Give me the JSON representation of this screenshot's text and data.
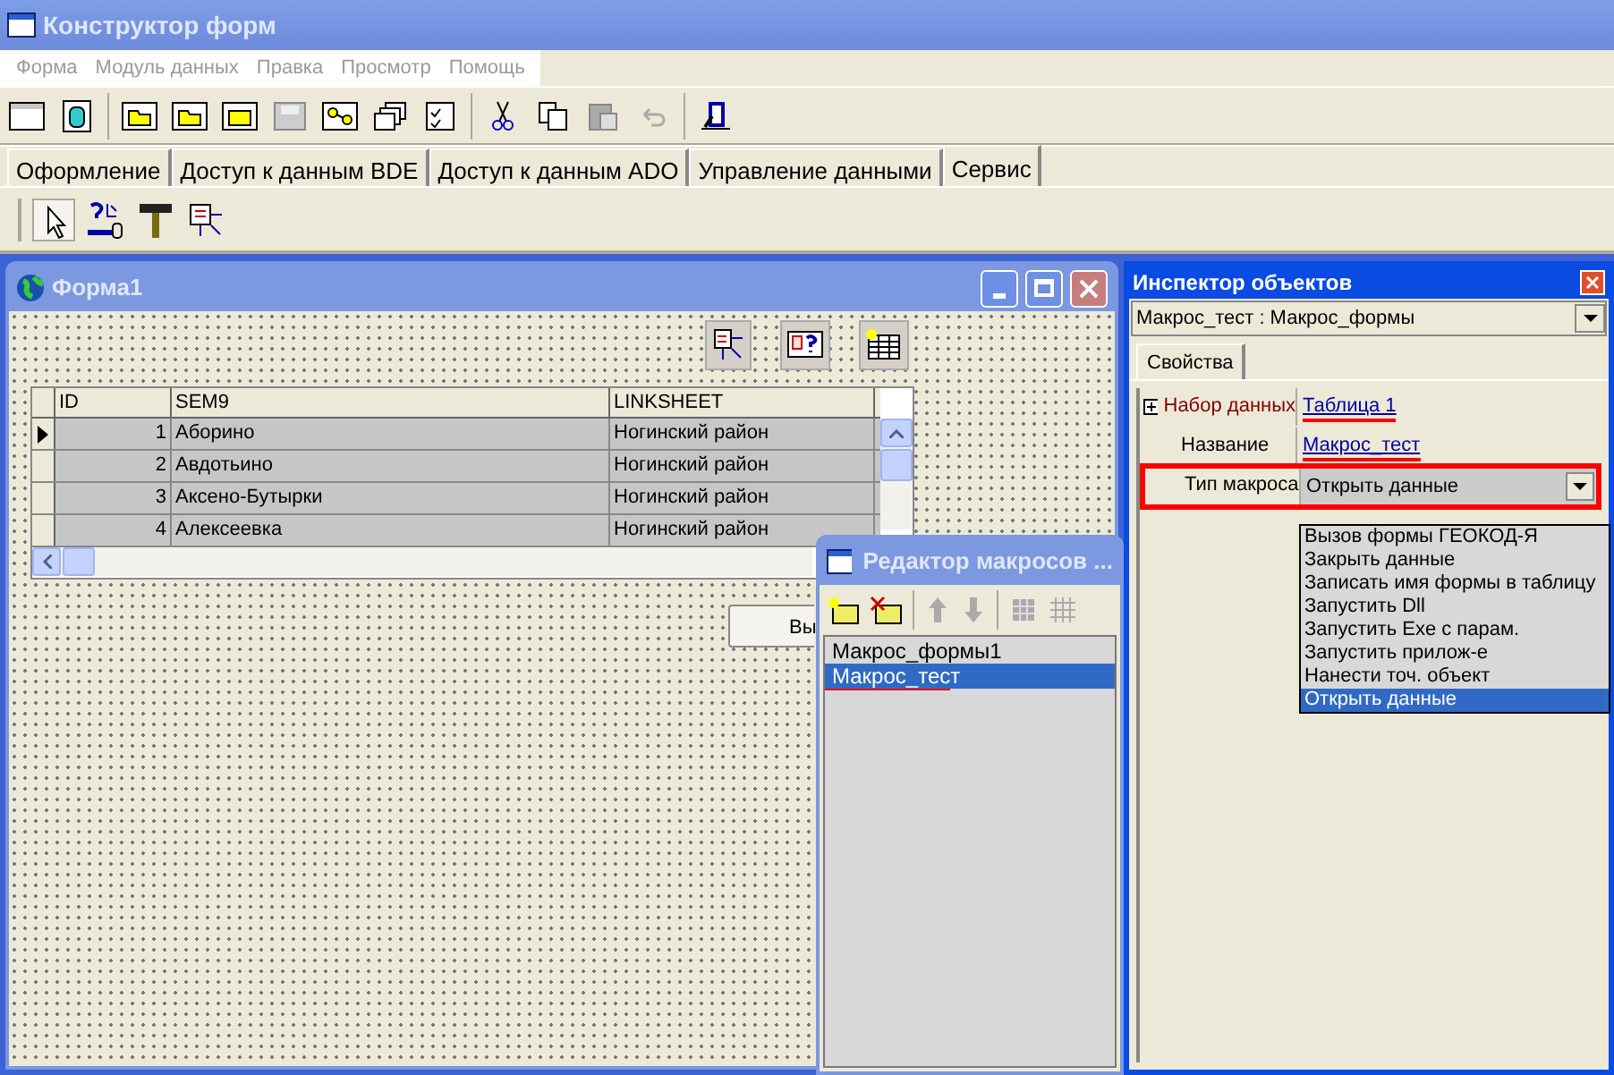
{
  "window": {
    "title": "Конструктор форм"
  },
  "menu": [
    "Форма",
    "Модуль данных",
    "Правка",
    "Просмотр",
    "Помощь"
  ],
  "palette_tabs": [
    {
      "label": "Оформление",
      "selected": false
    },
    {
      "label": "Доступ к данным BDE",
      "selected": false
    },
    {
      "label": "Доступ к данным ADO",
      "selected": false
    },
    {
      "label": "Управление данными",
      "selected": false
    },
    {
      "label": "Сервис",
      "selected": true
    }
  ],
  "form_window": {
    "title": "Форма1",
    "grid": {
      "columns": [
        "ID",
        "SEM9",
        "LINKSHEET"
      ],
      "rows": [
        {
          "id": "1",
          "sem9": "Аборино",
          "linksheet": "Ногинский район",
          "current": true
        },
        {
          "id": "2",
          "sem9": "Авдотьино",
          "linksheet": "Ногинский район",
          "current": false
        },
        {
          "id": "3",
          "sem9": "Аксено-Бутырки",
          "linksheet": "Ногинский район",
          "current": false
        },
        {
          "id": "4",
          "sem9": "Алексеевка",
          "linksheet": "Ногинский район",
          "current": false
        }
      ]
    },
    "button_label": "Вы"
  },
  "macro_editor": {
    "title": "Редактор макросов ...",
    "items": [
      {
        "label": "Макрос_формы1",
        "selected": false,
        "annotated": false
      },
      {
        "label": "Макрос_тест",
        "selected": true,
        "annotated": true
      }
    ]
  },
  "inspector": {
    "title": "Инспектор объектов",
    "object_selector": "Макрос_тест : Макрос_формы",
    "tabs": [
      {
        "label": "Свойства",
        "selected": true
      }
    ],
    "properties": [
      {
        "name": "Набор данных",
        "value": "Таблица 1",
        "kind": "expandable",
        "annotated": true
      },
      {
        "name": "Название",
        "value": "Макрос_тест",
        "kind": "text",
        "annotated": true
      },
      {
        "name": "Тип макроса",
        "value": "Открыть данные",
        "kind": "dropdown",
        "annotated": true
      }
    ],
    "dropdown_options": [
      {
        "label": "Вызов формы ГЕОКОД-Я",
        "selected": false
      },
      {
        "label": "Закрыть данные",
        "selected": false
      },
      {
        "label": "Записать имя формы в таблицу",
        "selected": false
      },
      {
        "label": "Запустить Dll",
        "selected": false
      },
      {
        "label": "Запустить Exe с парам.",
        "selected": false
      },
      {
        "label": "Запустить прилож-е",
        "selected": false
      },
      {
        "label": "Нанести точ. объект",
        "selected": false
      },
      {
        "label": "Открыть данные",
        "selected": true
      }
    ]
  }
}
